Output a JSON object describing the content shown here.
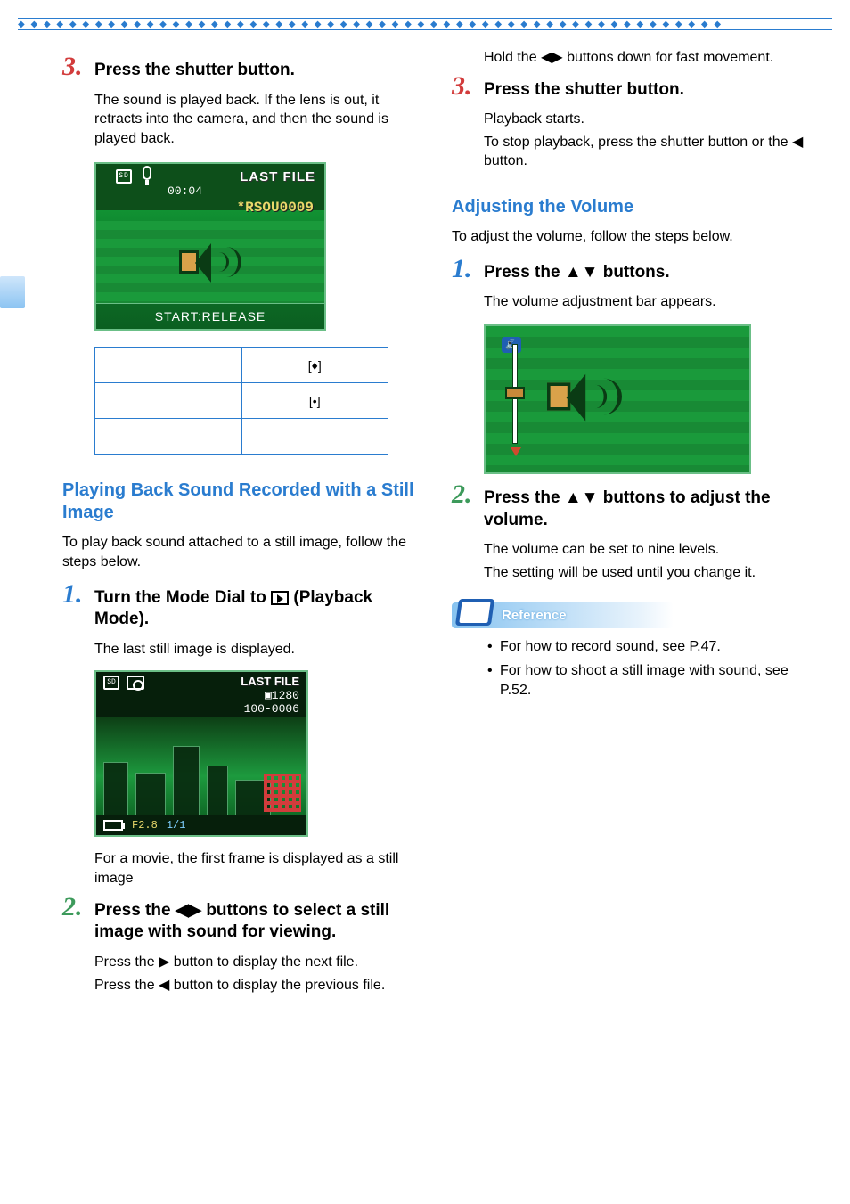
{
  "border": "diamond",
  "left": {
    "step3": {
      "num": "3.",
      "title": "Press the shutter button.",
      "body": "The sound is played back. If the lens is out, it retracts into the camera, and then the sound is played back."
    },
    "screen1": {
      "sd": "SD",
      "lastfile": "LAST FILE",
      "time": "00:04",
      "filename": "*RSOU0009",
      "bottom": "START:RELEASE"
    },
    "table": {
      "r1c1": "",
      "r1c2": "[♦]",
      "r2c1": "",
      "r2c2": "[•]",
      "r3c1": "",
      "r3c2": ""
    },
    "section1_title": "Playing Back Sound Recorded with a Still Image",
    "section1_intro": "To play back sound attached to a still image, follow the steps below.",
    "step1": {
      "num": "1.",
      "title_a": "Turn the Mode Dial to ",
      "title_b": " (Playback Mode).",
      "body": "The last still image is displayed."
    },
    "screen2": {
      "lastfile": "LAST FILE",
      "size": "▣1280",
      "fileno": "100-0006",
      "bottom_a": "F2.8",
      "bottom_b": "1/1"
    },
    "after_screen2": "For a movie, the first frame is displayed as a still image",
    "step2": {
      "num": "2.",
      "title": "Press the ◀▶ buttons to select a still image with sound for viewing.",
      "body_a": "Press the ▶ button to display the next file.",
      "body_b": "Press the ◀ button to display the previous file."
    }
  },
  "right": {
    "cont": "Hold the ◀▶ buttons down for fast movement.",
    "step3": {
      "num": "3.",
      "title": "Press the shutter button.",
      "body_a": "Playback starts.",
      "body_b": "To stop playback, press the shutter button or the ◀ button."
    },
    "section2_title": "Adjusting the Volume",
    "section2_intro": "To adjust the volume, follow the steps below.",
    "step1": {
      "num": "1.",
      "title": "Press the ▲▼ buttons.",
      "body": "The volume adjustment bar appears."
    },
    "step2": {
      "num": "2.",
      "title": "Press the ▲▼ buttons to adjust the volume.",
      "body_a": "The volume can be set to nine levels.",
      "body_b": "The setting will be used until you change it."
    },
    "reference_label": "Reference",
    "ref1": "For how to record sound, see P.47.",
    "ref2": "For how to shoot a still image with sound, see P.52."
  }
}
